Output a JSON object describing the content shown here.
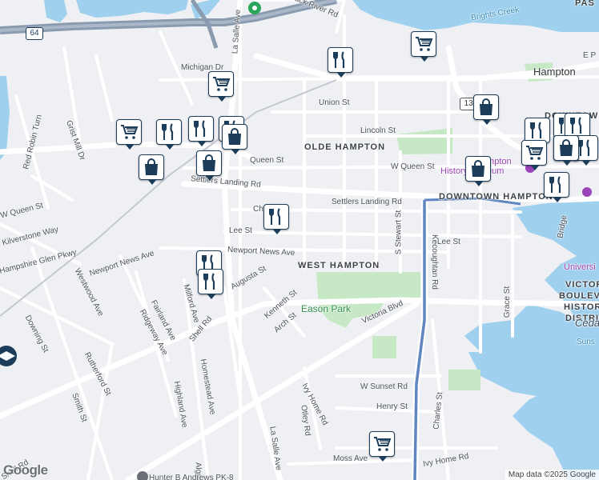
{
  "map": {
    "streets": {
      "back_river_rd": "Back River Rd",
      "la_salle_ave_top": "La Salle Ave",
      "michigan_dr": "Michigan Dr",
      "union_st": "Union St",
      "lincoln_st": "Lincoln St",
      "w_queen_st_right": "W Queen St",
      "queen_st_mid": "Queen St",
      "w_queen_st_left": "W Queen St",
      "red_robin_turn": "Red Robin Turn",
      "grist_mill_dr": "Grist Mill Dr",
      "settlers_landing_rd_left": "Settlers Landing Rd",
      "settlers_landing_rd_right": "Settlers Landing Rd",
      "chapel_st": "Chapel St",
      "lee_st_left": "Lee St",
      "lee_st_right": "Lee St",
      "kilverstone_way": "Kilverstone Way",
      "hampshire_glen_pkwy": "Hampshire Glen Pkwy",
      "newport_news_ave_left": "Newport News Ave",
      "newport_news_ave_mid": "Newport News Ave",
      "augusta_st": "Augusta St",
      "westwood_ave": "Westwood Ave",
      "ridgeway_ave": "Ridgeway Ave",
      "fairland_ave": "Fairland Ave",
      "milford_ave": "Milford Ave",
      "kenneth_st": "Kenneth St",
      "arch_st": "Arch St",
      "victoria_blvd": "Victoria Blvd",
      "kecoughtan_rd": "Kecoughtan Rd",
      "s_stewart_st": "S Stewart St",
      "grace_st": "Grace St",
      "downing_st": "Downing St",
      "rutherford_st": "Rutherford St",
      "smith_st": "Smith St",
      "shell_rd_mid": "Shell Rd",
      "shell_rd_bottom": "Shell Rd",
      "homestead_ave": "Homestead Ave",
      "highland_ave": "Highland Ave",
      "la_salle_ave_bottom": "La Salle Ave",
      "ivy_home_rd_mid": "Ivy Home Rd",
      "ivy_home_rd_bottom": "Ivy Home Rd",
      "otley_rd": "Otley Rd",
      "w_sunset_rd": "W Sunset Rd",
      "henry_st": "Henry St",
      "charles_st": "Charles St",
      "moss_ave": "Moss Ave",
      "algonquin_partial": "Algor",
      "e_pembroke_partial": "E P",
      "bridge_partial": "Bridge"
    },
    "districts": {
      "olde_hampton": "OLDE HAMPTON",
      "west_hampton": "WEST HAMPTON",
      "downtown_hampton": "DOWNTOWN HAMPTON",
      "downtown_top": "DOWNTOWN",
      "victoria_line1": "VICTORIA",
      "victoria_line2": "BOULEVARD",
      "victoria_line3": "HISTORIC",
      "victoria_line4": "DISTRICT",
      "pas_partial": "PAS"
    },
    "places": {
      "city": "Hampton",
      "brights_creek": "Brights Creek",
      "eason_park": "Eason Park",
      "hampton_label": "Hampton",
      "history_museum": "History Museum",
      "university_partial": "Universi",
      "cedar_partial": "Cedar",
      "sunset_partial": "Suns",
      "poi_bottom_partial": "Hunter B Andrews PK-8"
    },
    "shields": {
      "i64": "64",
      "route134": "134"
    },
    "pins": [
      {
        "type": "grocery"
      },
      {
        "type": "restaurant"
      },
      {
        "type": "grocery"
      },
      {
        "type": "shopping"
      },
      {
        "type": "grocery"
      },
      {
        "type": "restaurant"
      },
      {
        "type": "restaurant"
      },
      {
        "type": "restaurant"
      },
      {
        "type": "shopping"
      },
      {
        "type": "shopping"
      },
      {
        "type": "shopping"
      },
      {
        "type": "restaurant"
      },
      {
        "type": "restaurant"
      },
      {
        "type": "restaurant"
      },
      {
        "type": "restaurant"
      },
      {
        "type": "restaurant"
      },
      {
        "type": "shopping"
      },
      {
        "type": "restaurant"
      },
      {
        "type": "restaurant"
      },
      {
        "type": "grocery"
      },
      {
        "type": "shopping"
      },
      {
        "type": "restaurant"
      },
      {
        "type": "shopping"
      },
      {
        "type": "grocery"
      }
    ],
    "colors": {
      "pin_border": "#1c3d5a",
      "water": "#9fd0ee",
      "park": "#c6e8c4",
      "highway": "#8a9bb0",
      "kecoughtan": "#5f86c0"
    },
    "attribution": {
      "logo": "Google",
      "text": "Map data ©2025 Google"
    }
  }
}
